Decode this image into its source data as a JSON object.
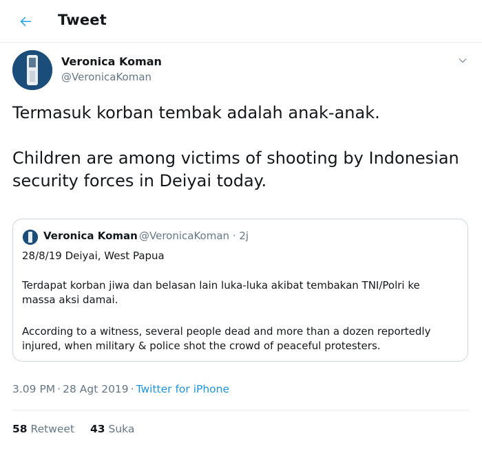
{
  "header": {
    "title": "Tweet",
    "back_icon": "arrow-left-icon"
  },
  "tweet": {
    "author_name": "Veronica Koman",
    "author_handle": "@VeronicaKoman",
    "text_line_1": "Termasuk korban tembak adalah anak-anak.",
    "text_line_2": "Children are among victims of shooting by Indonesian security forces in Deiyai today.",
    "menu_icon": "chevron-down-icon"
  },
  "quoted": {
    "author_name": "Veronica Koman",
    "author_handle": "@VeronicaKoman",
    "separator": "·",
    "age": "2j",
    "line_1": "28/8/19 Deiyai, West Papua",
    "line_2": "Terdapat korban jiwa dan belasan lain luka-luka akibat tembakan TNI/Polri ke massa aksi damai.",
    "line_3": "According to a witness, several people dead and more than a dozen reportedly injured, when military & police shot the crowd of peaceful protesters."
  },
  "meta": {
    "time": "3.09 PM",
    "date": "28 Agt 2019",
    "separator": "·",
    "source": "Twitter for iPhone"
  },
  "stats": {
    "retweet_count": "58",
    "retweet_label": "Retweet",
    "like_count": "43",
    "like_label": "Suka"
  },
  "colors": {
    "accent": "#1b95e0",
    "muted": "#657786",
    "text": "#14171a",
    "border": "#ccd6dd"
  }
}
